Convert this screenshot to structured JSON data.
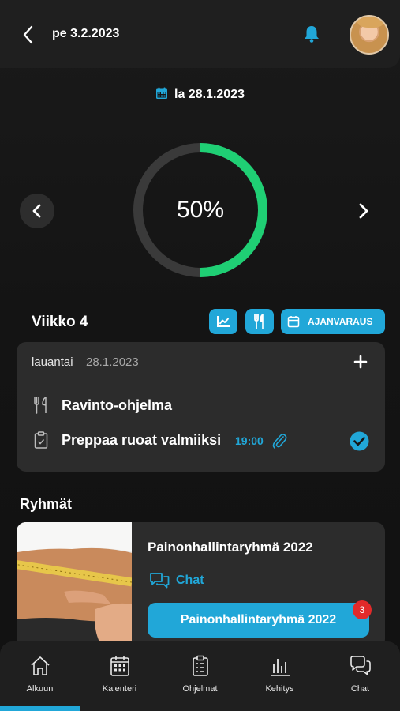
{
  "colors": {
    "accent": "#21a7d8",
    "progress": "#1fcf74",
    "track": "#3a3a3a",
    "badge": "#e22a2a"
  },
  "header": {
    "date": "pe 3.2.2023",
    "back_icon": "chevron-left-icon",
    "bell_icon": "bell-icon",
    "avatar": "user-avatar"
  },
  "selected_date": {
    "icon": "calendar-icon",
    "label": "la 28.1.2023"
  },
  "progress": {
    "value": 0.5,
    "label": "50%"
  },
  "week": {
    "title": "Viikko 4",
    "chart_icon": "chart-icon",
    "food_icon": "cutlery-icon",
    "booking_label": "AJANVARAUS"
  },
  "day": {
    "weekday": "lauantai",
    "date": "28.1.2023",
    "items": [
      {
        "icon": "cutlery-icon",
        "label": "Ravinto-ohjelma"
      },
      {
        "icon": "clipboard-check-icon",
        "label": "Preppaa ruoat valmiiksi",
        "time": "19:00",
        "attachment_icon": "paperclip-icon",
        "done": true
      }
    ]
  },
  "groups": {
    "title": "Ryhmät",
    "items": [
      {
        "name": "Painonhallintaryhmä 2022",
        "chat_label": "Chat",
        "button_label": "Painonhallintaryhmä 2022",
        "badge": "3"
      }
    ]
  },
  "tabs": [
    {
      "label": "Alkuun",
      "icon": "home-icon",
      "active": true
    },
    {
      "label": "Kalenteri",
      "icon": "calendar-icon"
    },
    {
      "label": "Ohjelmat",
      "icon": "clipboard-icon"
    },
    {
      "label": "Kehitys",
      "icon": "bar-chart-icon"
    },
    {
      "label": "Chat",
      "icon": "chat-bubbles-icon"
    }
  ]
}
